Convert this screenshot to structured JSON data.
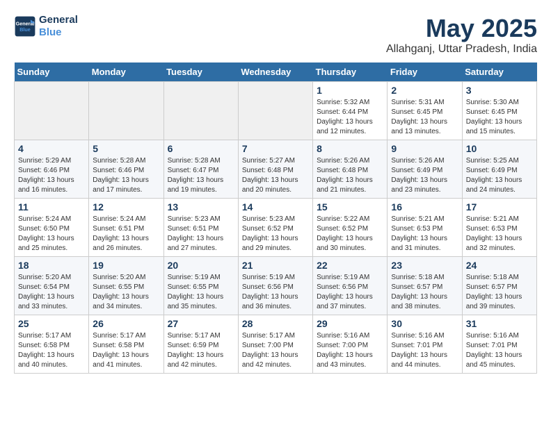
{
  "logo": {
    "line1": "General",
    "line2": "Blue"
  },
  "title": "May 2025",
  "subtitle": "Allahganj, Uttar Pradesh, India",
  "days_of_week": [
    "Sunday",
    "Monday",
    "Tuesday",
    "Wednesday",
    "Thursday",
    "Friday",
    "Saturday"
  ],
  "weeks": [
    [
      {
        "day": "",
        "info": ""
      },
      {
        "day": "",
        "info": ""
      },
      {
        "day": "",
        "info": ""
      },
      {
        "day": "",
        "info": ""
      },
      {
        "day": "1",
        "info": "Sunrise: 5:32 AM\nSunset: 6:44 PM\nDaylight: 13 hours\nand 12 minutes."
      },
      {
        "day": "2",
        "info": "Sunrise: 5:31 AM\nSunset: 6:45 PM\nDaylight: 13 hours\nand 13 minutes."
      },
      {
        "day": "3",
        "info": "Sunrise: 5:30 AM\nSunset: 6:45 PM\nDaylight: 13 hours\nand 15 minutes."
      }
    ],
    [
      {
        "day": "4",
        "info": "Sunrise: 5:29 AM\nSunset: 6:46 PM\nDaylight: 13 hours\nand 16 minutes."
      },
      {
        "day": "5",
        "info": "Sunrise: 5:28 AM\nSunset: 6:46 PM\nDaylight: 13 hours\nand 17 minutes."
      },
      {
        "day": "6",
        "info": "Sunrise: 5:28 AM\nSunset: 6:47 PM\nDaylight: 13 hours\nand 19 minutes."
      },
      {
        "day": "7",
        "info": "Sunrise: 5:27 AM\nSunset: 6:48 PM\nDaylight: 13 hours\nand 20 minutes."
      },
      {
        "day": "8",
        "info": "Sunrise: 5:26 AM\nSunset: 6:48 PM\nDaylight: 13 hours\nand 21 minutes."
      },
      {
        "day": "9",
        "info": "Sunrise: 5:26 AM\nSunset: 6:49 PM\nDaylight: 13 hours\nand 23 minutes."
      },
      {
        "day": "10",
        "info": "Sunrise: 5:25 AM\nSunset: 6:49 PM\nDaylight: 13 hours\nand 24 minutes."
      }
    ],
    [
      {
        "day": "11",
        "info": "Sunrise: 5:24 AM\nSunset: 6:50 PM\nDaylight: 13 hours\nand 25 minutes."
      },
      {
        "day": "12",
        "info": "Sunrise: 5:24 AM\nSunset: 6:51 PM\nDaylight: 13 hours\nand 26 minutes."
      },
      {
        "day": "13",
        "info": "Sunrise: 5:23 AM\nSunset: 6:51 PM\nDaylight: 13 hours\nand 27 minutes."
      },
      {
        "day": "14",
        "info": "Sunrise: 5:23 AM\nSunset: 6:52 PM\nDaylight: 13 hours\nand 29 minutes."
      },
      {
        "day": "15",
        "info": "Sunrise: 5:22 AM\nSunset: 6:52 PM\nDaylight: 13 hours\nand 30 minutes."
      },
      {
        "day": "16",
        "info": "Sunrise: 5:21 AM\nSunset: 6:53 PM\nDaylight: 13 hours\nand 31 minutes."
      },
      {
        "day": "17",
        "info": "Sunrise: 5:21 AM\nSunset: 6:53 PM\nDaylight: 13 hours\nand 32 minutes."
      }
    ],
    [
      {
        "day": "18",
        "info": "Sunrise: 5:20 AM\nSunset: 6:54 PM\nDaylight: 13 hours\nand 33 minutes."
      },
      {
        "day": "19",
        "info": "Sunrise: 5:20 AM\nSunset: 6:55 PM\nDaylight: 13 hours\nand 34 minutes."
      },
      {
        "day": "20",
        "info": "Sunrise: 5:19 AM\nSunset: 6:55 PM\nDaylight: 13 hours\nand 35 minutes."
      },
      {
        "day": "21",
        "info": "Sunrise: 5:19 AM\nSunset: 6:56 PM\nDaylight: 13 hours\nand 36 minutes."
      },
      {
        "day": "22",
        "info": "Sunrise: 5:19 AM\nSunset: 6:56 PM\nDaylight: 13 hours\nand 37 minutes."
      },
      {
        "day": "23",
        "info": "Sunrise: 5:18 AM\nSunset: 6:57 PM\nDaylight: 13 hours\nand 38 minutes."
      },
      {
        "day": "24",
        "info": "Sunrise: 5:18 AM\nSunset: 6:57 PM\nDaylight: 13 hours\nand 39 minutes."
      }
    ],
    [
      {
        "day": "25",
        "info": "Sunrise: 5:17 AM\nSunset: 6:58 PM\nDaylight: 13 hours\nand 40 minutes."
      },
      {
        "day": "26",
        "info": "Sunrise: 5:17 AM\nSunset: 6:58 PM\nDaylight: 13 hours\nand 41 minutes."
      },
      {
        "day": "27",
        "info": "Sunrise: 5:17 AM\nSunset: 6:59 PM\nDaylight: 13 hours\nand 42 minutes."
      },
      {
        "day": "28",
        "info": "Sunrise: 5:17 AM\nSunset: 7:00 PM\nDaylight: 13 hours\nand 42 minutes."
      },
      {
        "day": "29",
        "info": "Sunrise: 5:16 AM\nSunset: 7:00 PM\nDaylight: 13 hours\nand 43 minutes."
      },
      {
        "day": "30",
        "info": "Sunrise: 5:16 AM\nSunset: 7:01 PM\nDaylight: 13 hours\nand 44 minutes."
      },
      {
        "day": "31",
        "info": "Sunrise: 5:16 AM\nSunset: 7:01 PM\nDaylight: 13 hours\nand 45 minutes."
      }
    ]
  ]
}
